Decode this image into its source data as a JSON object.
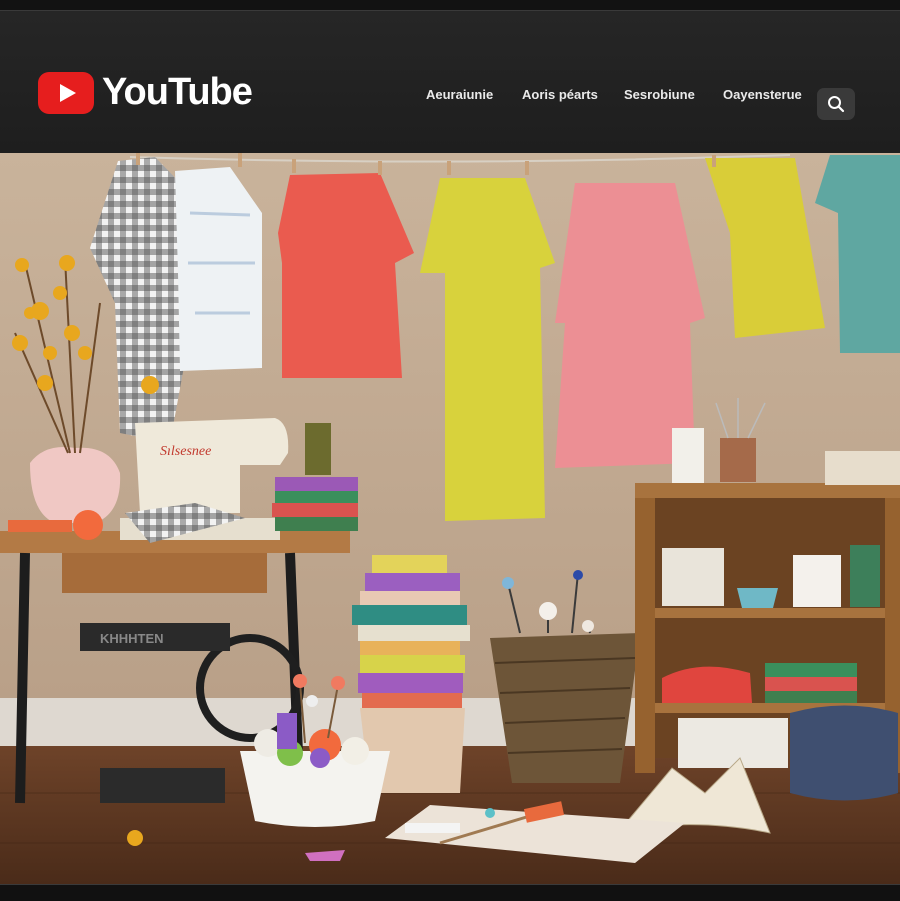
{
  "app": {
    "logo_text": "YouTube"
  },
  "nav": {
    "items": [
      "Aeuraiunie",
      "Aoris péarts",
      "Sesrobiune",
      "Oayensterue"
    ]
  },
  "search": {
    "icon": "search-icon"
  },
  "hero": {
    "sewing_machine_label": "Sılsesnee",
    "table_base_label": "KHHHTEN"
  },
  "colors": {
    "header_bg": "#242424",
    "brand_red": "#e61e1e",
    "wall": "#cdb8a0",
    "floor": "#6a4127"
  }
}
